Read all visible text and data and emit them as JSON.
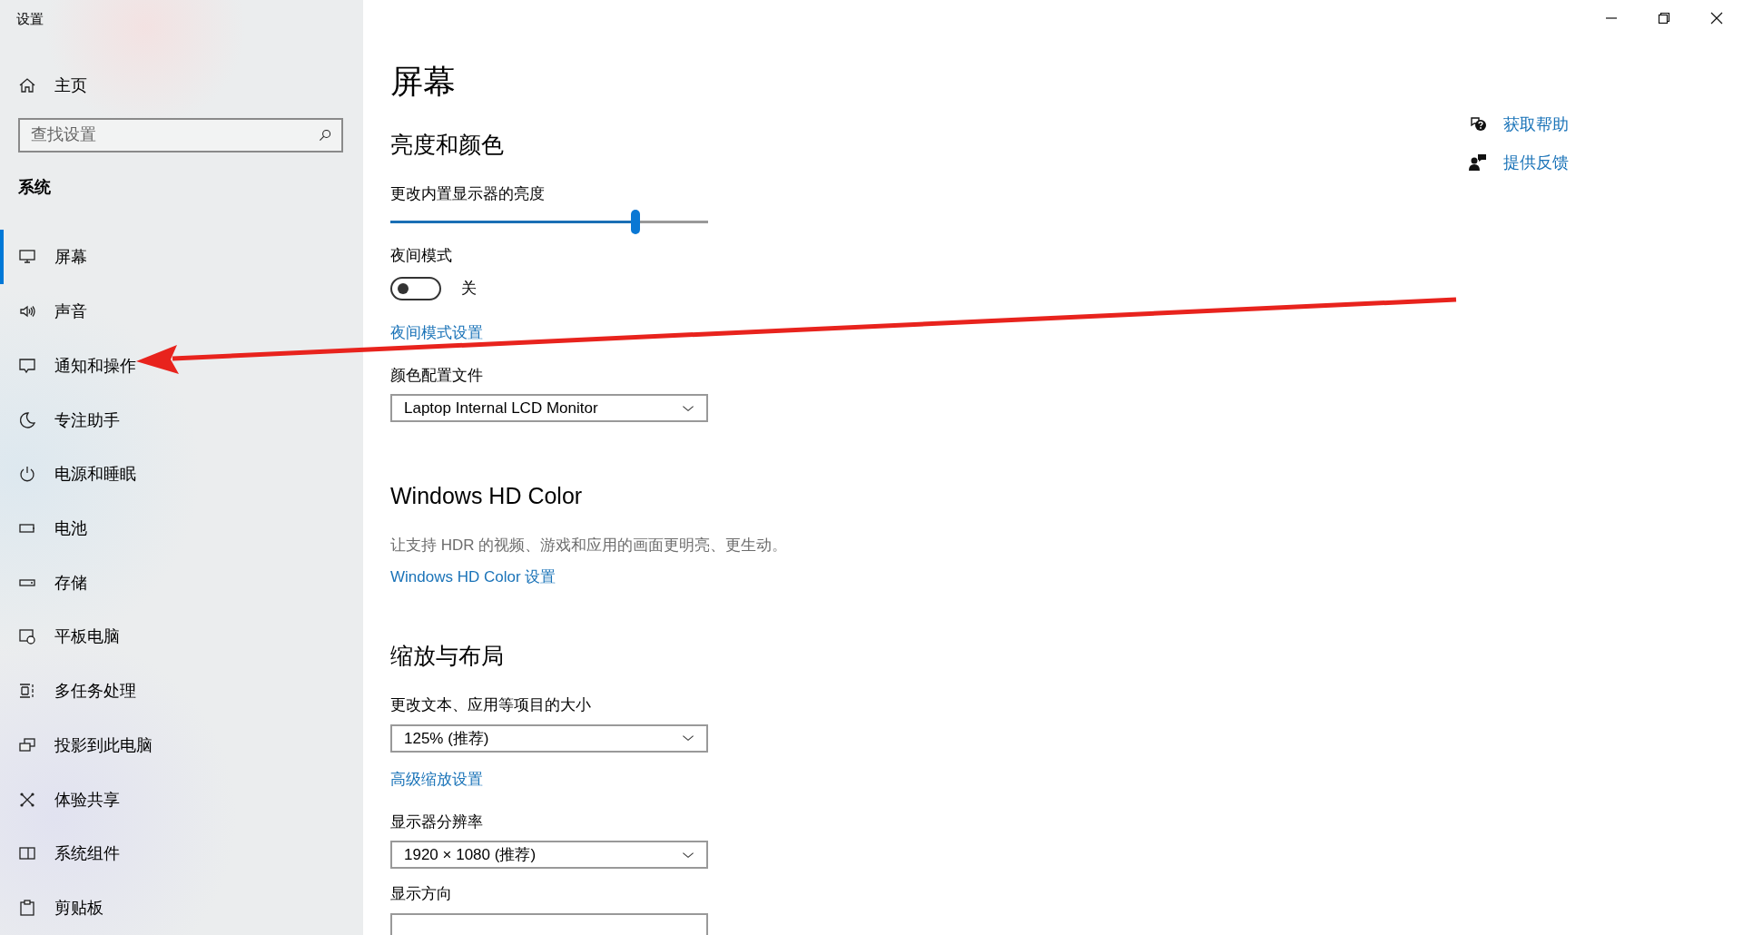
{
  "window": {
    "title": "设置"
  },
  "sidebar": {
    "home": {
      "label": "主页"
    },
    "search": {
      "placeholder": "查找设置"
    },
    "section": "系统",
    "items": [
      {
        "label": "屏幕",
        "selected": true
      },
      {
        "label": "声音",
        "selected": false
      },
      {
        "label": "通知和操作",
        "selected": false
      },
      {
        "label": "专注助手",
        "selected": false
      },
      {
        "label": "电源和睡眠",
        "selected": false
      },
      {
        "label": "电池",
        "selected": false
      },
      {
        "label": "存储",
        "selected": false
      },
      {
        "label": "平板电脑",
        "selected": false
      },
      {
        "label": "多任务处理",
        "selected": false
      },
      {
        "label": "投影到此电脑",
        "selected": false
      },
      {
        "label": "体验共享",
        "selected": false
      },
      {
        "label": "系统组件",
        "selected": false
      },
      {
        "label": "剪贴板",
        "selected": false
      }
    ]
  },
  "main": {
    "title": "屏幕",
    "blocks": [
      {
        "kind": "heading",
        "text": "亮度和颜色"
      },
      {
        "kind": "label",
        "text": "更改内置显示器的亮度"
      },
      {
        "kind": "slider",
        "level": 0.77
      },
      {
        "kind": "label",
        "text": "夜间模式"
      },
      {
        "kind": "toggle",
        "on": false,
        "state_text": "关"
      },
      {
        "kind": "link",
        "text": "夜间模式设置"
      },
      {
        "kind": "label",
        "text": "颜色配置文件"
      },
      {
        "kind": "dropdown",
        "value": "Laptop Internal LCD Monitor"
      },
      {
        "kind": "heading",
        "text": "Windows HD Color"
      },
      {
        "kind": "description",
        "text": "让支持 HDR 的视频、游戏和应用的画面更明亮、更生动。"
      },
      {
        "kind": "link",
        "text": "Windows HD Color 设置"
      },
      {
        "kind": "heading",
        "text": "缩放与布局"
      },
      {
        "kind": "label",
        "text": "更改文本、应用等项目的大小"
      },
      {
        "kind": "dropdown",
        "value": "125% (推荐)"
      },
      {
        "kind": "link",
        "text": "高级缩放设置"
      },
      {
        "kind": "label",
        "text": "显示器分辨率"
      },
      {
        "kind": "dropdown",
        "value": "1920 × 1080 (推荐)"
      },
      {
        "kind": "label",
        "text": "显示方向"
      },
      {
        "kind": "dropdown"
      }
    ]
  },
  "help_links": [
    {
      "kind": "help",
      "label": "获取帮助"
    },
    {
      "kind": "feedback",
      "label": "提供反馈"
    }
  ]
}
